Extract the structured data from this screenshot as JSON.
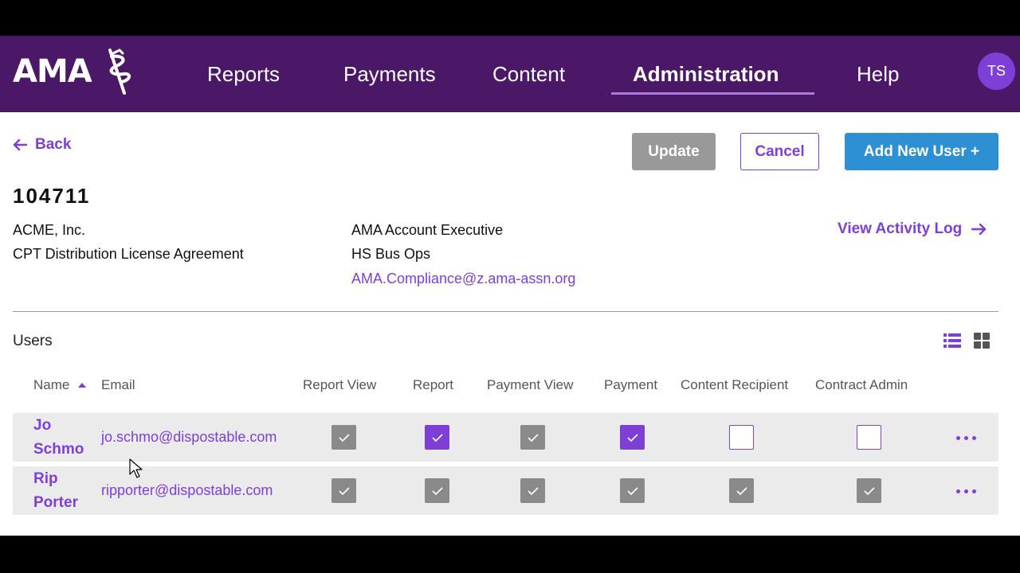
{
  "nav": {
    "logo_text": "AMA",
    "items": [
      {
        "label": "Reports"
      },
      {
        "label": "Payments"
      },
      {
        "label": "Content"
      },
      {
        "label": "Administration",
        "active": true
      },
      {
        "label": "Help"
      }
    ],
    "avatar_initials": "TS"
  },
  "toolbar": {
    "back_label": "Back",
    "update_label": "Update",
    "cancel_label": "Cancel",
    "add_user_label": "Add New User +"
  },
  "account": {
    "id": "104711",
    "company": "ACME, Inc.",
    "agreement": "CPT Distribution License Agreement",
    "exec_title": "AMA Account Executive",
    "exec_name": "HS Bus Ops",
    "exec_email": "AMA.Compliance@z.ama-assn.org",
    "activity_log_label": "View Activity Log"
  },
  "users": {
    "section_label": "Users",
    "columns": {
      "name": "Name",
      "email": "Email",
      "report_view": "Report View",
      "report": "Report",
      "payment_view": "Payment View",
      "payment": "Payment",
      "content_recipient": "Content Recipient",
      "contract_admin": "Contract Admin"
    },
    "sort": {
      "column": "Name",
      "direction": "ascending"
    },
    "rows": [
      {
        "name": "Jo Schmo",
        "email": "jo.schmo@dispostable.com",
        "permissions": {
          "report_view": "checked-grey",
          "report": "checked-purple",
          "payment_view": "checked-grey",
          "payment": "checked-purple",
          "content_recipient": "unchecked",
          "contract_admin": "unchecked"
        }
      },
      {
        "name": "Rip Porter",
        "email": "ripporter@dispostable.com",
        "permissions": {
          "report_view": "checked-grey",
          "report": "checked-grey",
          "payment_view": "checked-grey",
          "payment": "checked-grey",
          "content_recipient": "checked-grey",
          "contract_admin": "checked-grey"
        }
      }
    ]
  },
  "colors": {
    "nav_bg": "#4b1867",
    "accent_purple": "#7e3fd6",
    "add_button_blue": "#2d90d3",
    "disabled_grey": "#999999",
    "checkbox_grey": "#8a8a8a",
    "row_bg": "#ebebeb"
  },
  "icons": [
    "back-arrow-icon",
    "forward-arrow-icon",
    "sort-ascending-icon",
    "list-view-icon",
    "grid-view-icon",
    "more-options-icon",
    "check-icon",
    "mouse-pointer-icon"
  ]
}
